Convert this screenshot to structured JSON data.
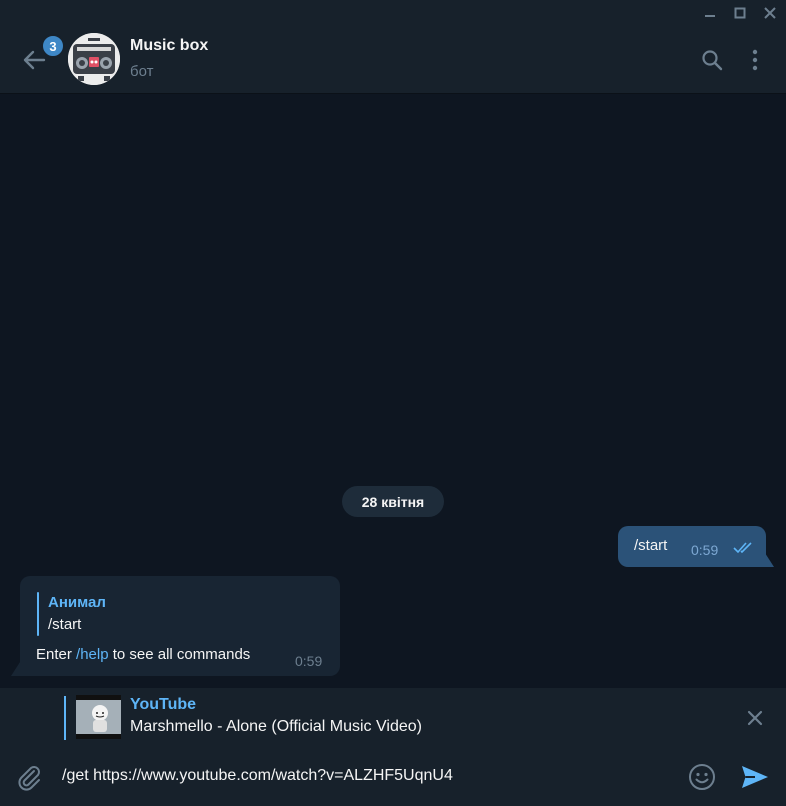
{
  "header": {
    "title": "Music box",
    "subtitle": "бот",
    "unread_count": "3"
  },
  "messages": {
    "date_separator": "28 квітня",
    "outgoing": {
      "text": "/start",
      "time": "0:59"
    },
    "incoming": {
      "reply_name": "Анимал",
      "reply_text": "/start",
      "text_before": "Enter ",
      "link": "/help",
      "text_after": " to see all commands",
      "time": "0:59"
    }
  },
  "link_preview": {
    "site": "YouTube",
    "title": "Marshmello - Alone (Official Music Video)"
  },
  "composer": {
    "value": "/get https://www.youtube.com/watch?v=ALZHF5UqnU4"
  },
  "colors": {
    "background": "#0e1621",
    "panel": "#17212b",
    "accent": "#5eb5f7",
    "outgoing_bubble": "#2b5278",
    "incoming_bubble": "#182533"
  }
}
